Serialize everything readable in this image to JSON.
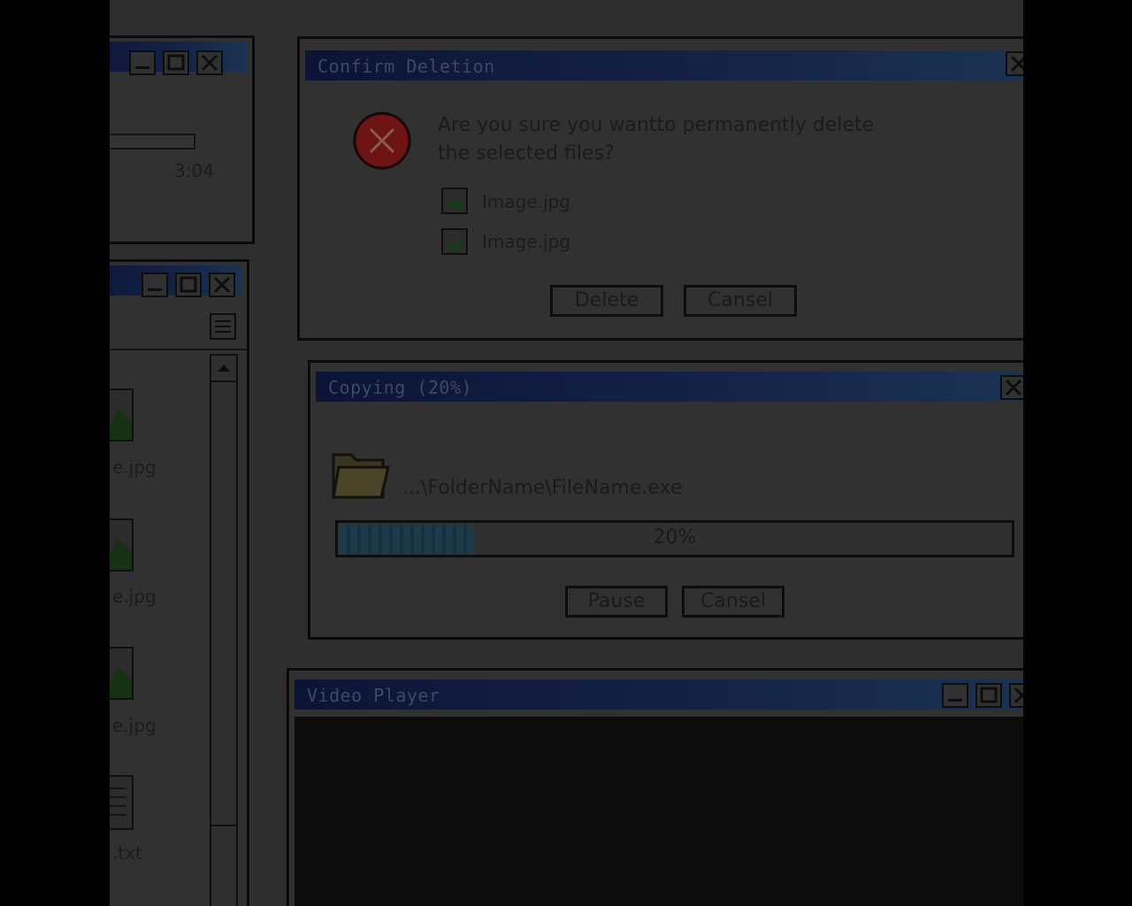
{
  "colors": {
    "titlebar_start": "#0c1437",
    "titlebar_end": "#1b3352",
    "error_red": "#6e1414",
    "folder": "#4a4428",
    "progress_fill": "#1d3a4a"
  },
  "media_window": {
    "time": "3:04"
  },
  "explorer_window": {
    "files": [
      {
        "label": "e.jpg",
        "icon": "image-icon"
      },
      {
        "label": "e.jpg",
        "icon": "image-icon"
      },
      {
        "label": "e.jpg",
        "icon": "image-icon"
      },
      {
        "label": ".txt",
        "icon": "text-file-icon"
      }
    ]
  },
  "confirm_dialog": {
    "title": "Confirm Deletion",
    "message_line1": "Are you sure you wantto permanently delete",
    "message_line2": "the selected files?",
    "files": [
      "Image.jpg",
      "Image.jpg"
    ],
    "delete_label": "Delete",
    "cancel_label": "Cansel"
  },
  "copy_dialog": {
    "title": "Copying (20%)",
    "path": "...\\FolderName\\FileName.exe",
    "progress": 0.2,
    "progress_text": "20%",
    "pause_label": "Pause",
    "cancel_label": "Cansel"
  },
  "video_window": {
    "title": "Video Player"
  }
}
